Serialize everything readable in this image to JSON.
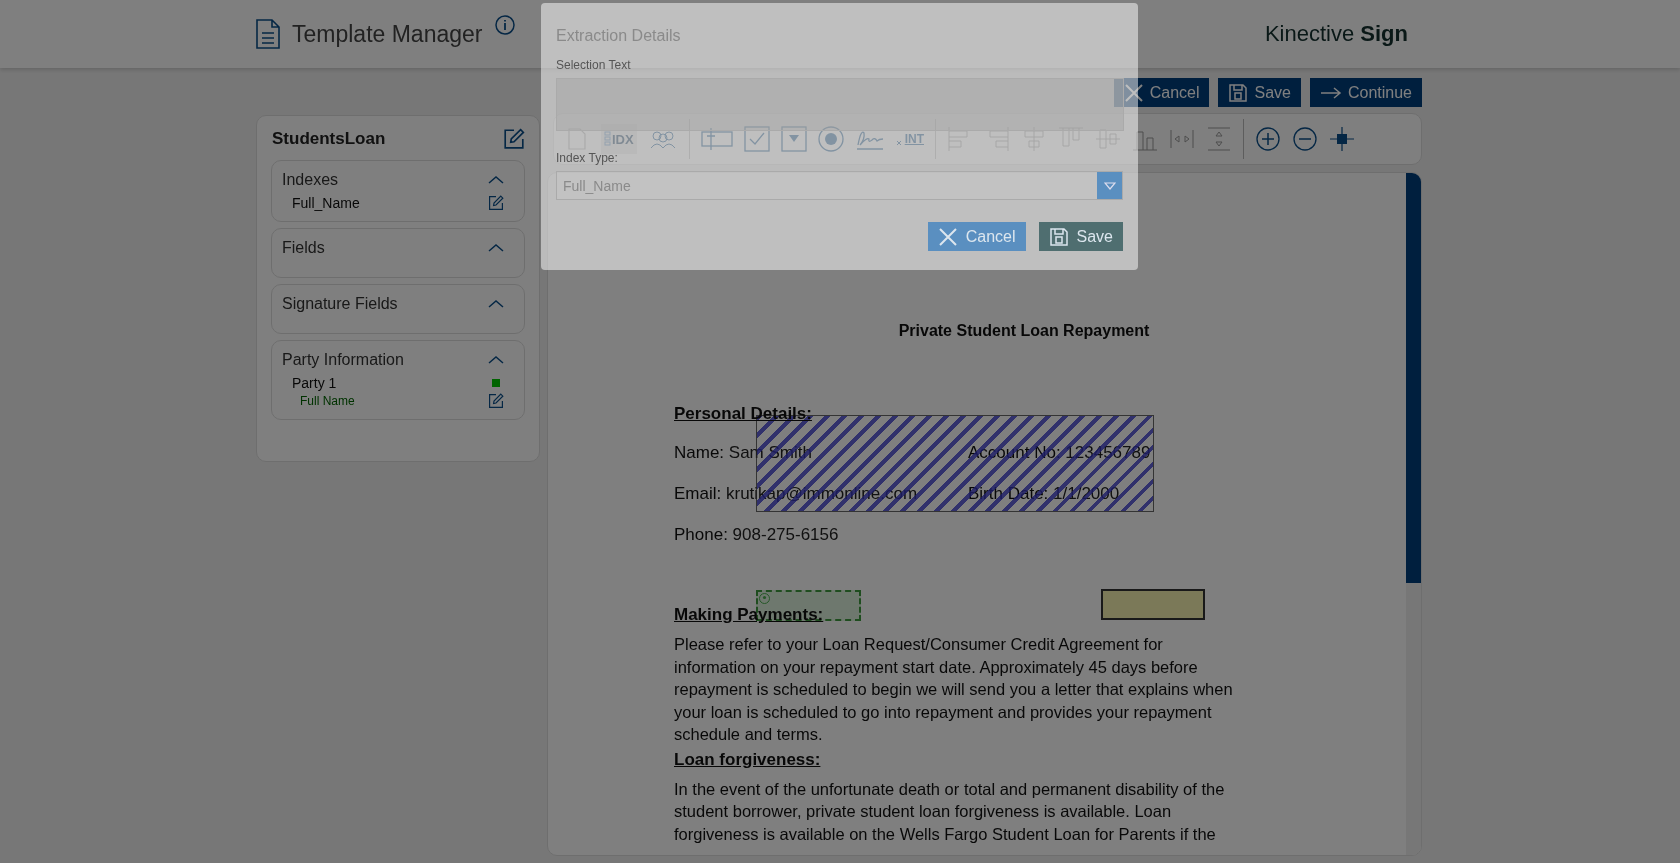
{
  "header": {
    "title": "Template Manager",
    "brand": {
      "name": "Kinective",
      "emphasis": "Sign"
    }
  },
  "actions": [
    {
      "kind": "cancel",
      "label": "Cancel"
    },
    {
      "kind": "save",
      "label": "Save"
    },
    {
      "kind": "continue",
      "label": "Continue"
    }
  ],
  "toolbar": {
    "tools": [
      {
        "kind": "document",
        "selected": false
      },
      {
        "kind": "index",
        "label": "IDX",
        "selected": true
      },
      {
        "kind": "parties",
        "selected": false
      },
      {
        "kind": "separator"
      },
      {
        "kind": "text-field",
        "selected": false
      },
      {
        "kind": "checkbox",
        "selected": false
      },
      {
        "kind": "dropdown",
        "selected": false
      },
      {
        "kind": "radio",
        "selected": false
      },
      {
        "kind": "signature",
        "selected": false
      },
      {
        "kind": "integer",
        "label": "INT",
        "selected": false
      },
      {
        "kind": "separator"
      },
      {
        "kind": "align-left",
        "selected": false
      },
      {
        "kind": "align-right",
        "selected": false
      },
      {
        "kind": "align-center",
        "selected": false
      },
      {
        "kind": "align-top",
        "selected": false
      },
      {
        "kind": "align-middle",
        "selected": false
      },
      {
        "kind": "align-bottom",
        "selected": false
      },
      {
        "kind": "space-horizontal",
        "selected": false
      },
      {
        "kind": "space-vertical",
        "selected": false
      },
      {
        "kind": "separator"
      },
      {
        "kind": "zoom-in",
        "selected": false
      },
      {
        "kind": "zoom-out",
        "selected": false
      },
      {
        "kind": "fit",
        "selected": false
      }
    ]
  },
  "sidebar": {
    "template_name": "StudentsLoan",
    "sections": [
      {
        "title": "Indexes",
        "expanded": true,
        "items": [
          {
            "label": "Full_Name"
          }
        ]
      },
      {
        "title": "Fields",
        "expanded": true
      },
      {
        "title": "Signature Fields",
        "expanded": true
      },
      {
        "title": "Party Information",
        "expanded": true,
        "items": [
          {
            "label": "Party 1",
            "color": "#006400",
            "children": [
              {
                "label": "Full Name"
              }
            ]
          }
        ]
      }
    ]
  },
  "document": {
    "title": "Private Student Loan Repayment",
    "blocks": [
      {
        "kind": "heading",
        "text": "Personal Details:"
      },
      {
        "kind": "fields",
        "rows": [
          [
            {
              "label": "Name:",
              "value": "Sam Smith"
            },
            {
              "label": "Account No:",
              "value": "123456789"
            }
          ],
          [
            {
              "label": "Email:",
              "value": "krutikap@immonline.com"
            },
            {
              "label": "Birth Date:",
              "value": "1/1/2000"
            }
          ],
          [
            {
              "label": "Phone:",
              "value": "908-275-6156"
            }
          ]
        ]
      },
      {
        "kind": "heading",
        "text": "Making Payments:"
      },
      {
        "kind": "paragraph",
        "text": "Please refer to your Loan Request/Consumer Credit Agreement for information on your repayment start date. Approximately 45 days before repayment is scheduled to begin we will send you a letter that explains when your loan is scheduled to go into repayment and provides your repayment schedule and terms."
      },
      {
        "kind": "heading",
        "text": "Loan forgiveness:"
      },
      {
        "kind": "paragraph",
        "text": "In the event of the unfortunate death or total and permanent disability of the student borrower, private student loan forgiveness is available. Loan forgiveness is available on the Wells Fargo Student Loan for Parents if the"
      }
    ]
  },
  "dialog": {
    "title": "Extraction Details",
    "selection_label": "Selection Text",
    "index_label": "Index Type:",
    "index_value": "Full_Name",
    "buttons": [
      {
        "kind": "cancel",
        "label": "Cancel"
      },
      {
        "kind": "save",
        "label": "Save"
      }
    ]
  }
}
